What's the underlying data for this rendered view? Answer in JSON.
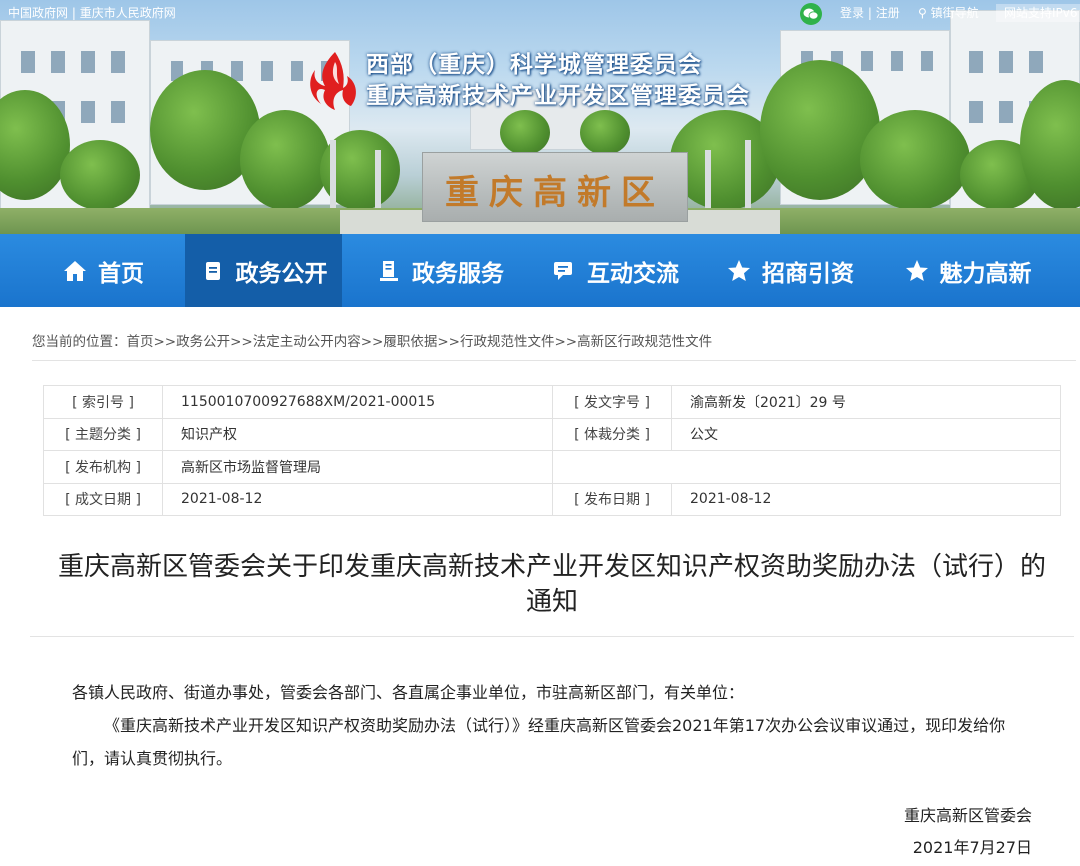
{
  "topbar": {
    "gov_link": "中国政府网",
    "divider": "|",
    "cq_link": "重庆市人民政府网",
    "login": "登录",
    "login_sep": "|",
    "register": "注册",
    "street_nav": "镇街导航",
    "ipv6": "网站支持IPv6"
  },
  "banner": {
    "org_line1": "西部（重庆）科学城管理委员会",
    "org_line2": "重庆高新技术产业开发区管理委员会",
    "stone_text": "重庆高新区"
  },
  "nav": {
    "items": [
      {
        "label": "首页",
        "icon": "home-icon"
      },
      {
        "label": "政务公开",
        "icon": "document-icon"
      },
      {
        "label": "政务服务",
        "icon": "service-icon"
      },
      {
        "label": "互动交流",
        "icon": "chat-icon"
      },
      {
        "label": "招商引资",
        "icon": "star-icon"
      },
      {
        "label": "魅力高新",
        "icon": "star-icon"
      }
    ],
    "active_index": 1
  },
  "breadcrumb": {
    "prefix": "您当前的位置：",
    "items": [
      "首页",
      "政务公开",
      "法定主动公开内容",
      "履职依据",
      "行政规范性文件",
      "高新区行政规范性文件"
    ],
    "separator": ">>"
  },
  "meta": {
    "index_label": "[ 索引号 ]",
    "index_value": "1150010700927688XM/2021-00015",
    "doc_no_label": "[ 发文字号 ]",
    "doc_no_value": "渝高新发〔2021〕29 号",
    "topic_label": "[ 主题分类 ]",
    "topic_value": "知识产权",
    "genre_label": "[ 体裁分类 ]",
    "genre_value": "公文",
    "issuer_label": "[ 发布机构 ]",
    "issuer_value": "高新区市场监督管理局",
    "created_label": "[ 成文日期 ]",
    "created_value": "2021-08-12",
    "published_label": "[ 发布日期 ]",
    "published_value": "2021-08-12"
  },
  "article": {
    "title_line1": "重庆高新区管委会关于印发重庆高新技术产业开发区知识产权资助奖励办法（试行）的",
    "title_line2": "通知",
    "salutation": "各镇人民政府、街道办事处，管委会各部门、各直属企事业单位，市驻高新区部门，有关单位：",
    "paragraph": "《重庆高新技术产业开发区知识产权资助奖励办法（试行）》经重庆高新区管委会2021年第17次办公会议审议通过，现印发给你们，请认真贯彻执行。",
    "signer": "重庆高新区管委会",
    "date": "2021年7月27日"
  }
}
